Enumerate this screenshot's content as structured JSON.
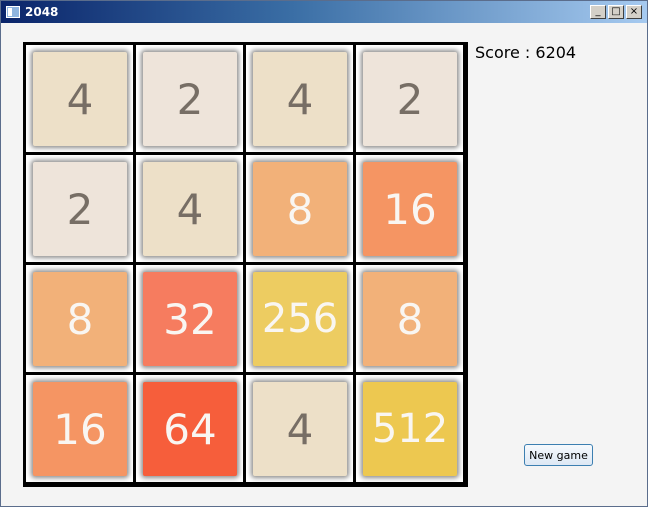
{
  "window": {
    "title": "2048",
    "minimize_glyph": "_",
    "maximize_glyph": "□",
    "close_glyph": "×"
  },
  "score": {
    "label": "Score :",
    "value": "6204"
  },
  "new_game_label": "New game",
  "colors": {
    "2": "#eee4da",
    "4": "#ede0c8",
    "8": "#f2b179",
    "16": "#f59563",
    "32": "#f67c5f",
    "64": "#f65e3b",
    "256": "#edcc61",
    "512": "#edc850"
  },
  "board": [
    [
      4,
      2,
      4,
      2
    ],
    [
      2,
      4,
      8,
      16
    ],
    [
      8,
      32,
      256,
      8
    ],
    [
      16,
      64,
      4,
      512
    ]
  ]
}
